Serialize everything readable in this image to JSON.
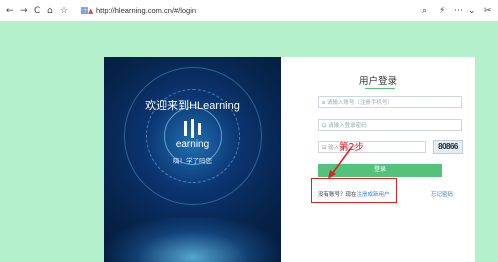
{
  "browser": {
    "url": "http://hlearning.com.cn/#/login",
    "icons": [
      "back-icon",
      "forward-icon",
      "reload-icon",
      "home-icon",
      "star-icon",
      "tab-icon",
      "lock-icon",
      "search-icon",
      "lightning-icon",
      "menu-icon",
      "chevron-down-icon",
      "scissors-icon"
    ]
  },
  "left_panel": {
    "welcome": "欢迎来到HLearning",
    "logo_text": "earning",
    "slogan": "嗨！学了吗您"
  },
  "login": {
    "title": "用户登录",
    "account_placeholder": "请输入账号（注册手机号）",
    "password_placeholder": "请输入登录密码",
    "captcha_placeholder": "输入验证码",
    "captcha_image_text": "80866",
    "submit_label": "登录",
    "no_account_text": "没有账号？现在",
    "register_link": "注册成新用户",
    "forgot_password": "忘记密码"
  },
  "annotation": {
    "step_label": "第2步",
    "color": "#e02020"
  },
  "colors": {
    "page_bg": "#b4f0cc",
    "button": "#52c27c",
    "title_underline": "#52c27c"
  }
}
